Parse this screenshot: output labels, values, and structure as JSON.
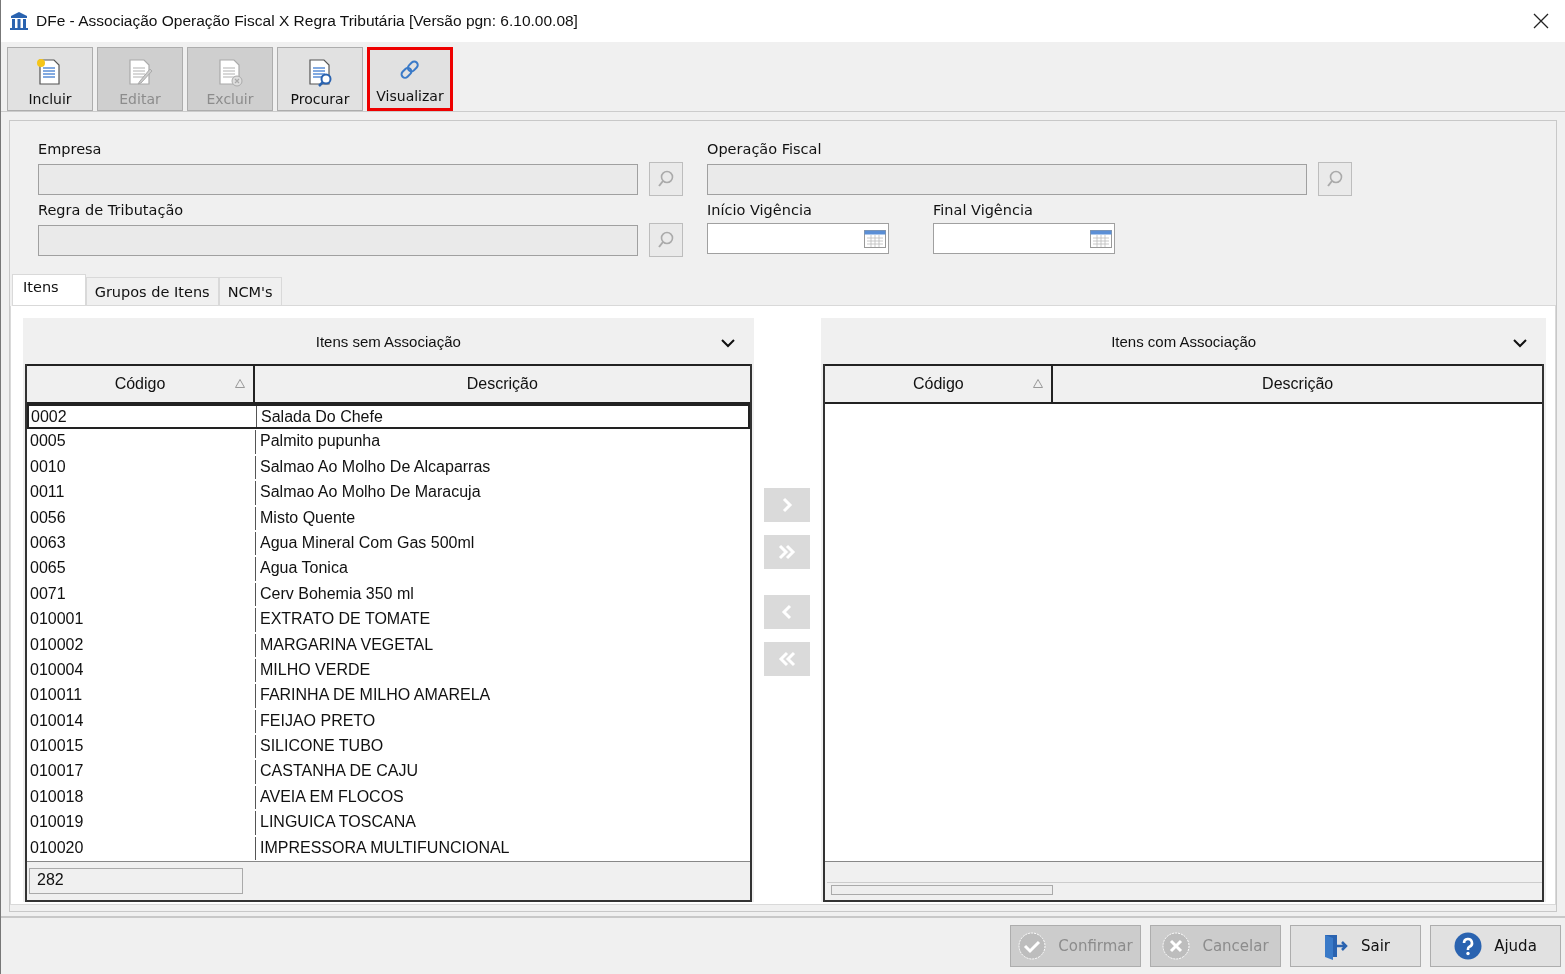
{
  "window": {
    "title": "DFe - Associação Operação Fiscal X Regra Tributária [Versão pgn: 6.10.00.08]"
  },
  "toolbar": [
    {
      "kind": "new",
      "label": "Incluir",
      "disabled": false,
      "highlighted": false
    },
    {
      "kind": "edit",
      "label": "Editar",
      "disabled": true,
      "highlighted": false
    },
    {
      "kind": "delete",
      "label": "Excluir",
      "disabled": true,
      "highlighted": false
    },
    {
      "kind": "search",
      "label": "Procurar",
      "disabled": false,
      "highlighted": false
    },
    {
      "kind": "link",
      "label": "Visualizar",
      "disabled": false,
      "highlighted": true
    }
  ],
  "form": {
    "fields": [
      {
        "kind": "lookup",
        "label": "Empresa"
      },
      {
        "kind": "lookup",
        "label": "Operação Fiscal"
      },
      {
        "kind": "lookup",
        "label": "Regra de Tributação"
      },
      {
        "kind": "date",
        "label": "Início Vigência"
      },
      {
        "kind": "date",
        "label": "Final Vigência"
      }
    ]
  },
  "tabs": [
    {
      "label": "Itens",
      "selected": true
    },
    {
      "label": "Grupos de Itens",
      "selected": false
    },
    {
      "label": "NCM's",
      "selected": false
    }
  ],
  "left_list": {
    "title": "Itens sem Associação",
    "columns": [
      "Código",
      "Descrição"
    ],
    "count": "282",
    "rows": [
      {
        "code": "0002",
        "description": "Salada Do Chefe",
        "selected": true
      },
      {
        "code": "0005",
        "description": "Palmito pupunha",
        "selected": false
      },
      {
        "code": "0010",
        "description": "Salmao Ao Molho De Alcaparras",
        "selected": false
      },
      {
        "code": "0011",
        "description": "Salmao Ao Molho De Maracuja",
        "selected": false
      },
      {
        "code": "0056",
        "description": "Misto Quente",
        "selected": false
      },
      {
        "code": "0063",
        "description": "Agua Mineral Com Gas 500ml",
        "selected": false
      },
      {
        "code": "0065",
        "description": "Agua Tonica",
        "selected": false
      },
      {
        "code": "0071",
        "description": "Cerv Bohemia 350 ml",
        "selected": false
      },
      {
        "code": "010001",
        "description": "EXTRATO DE TOMATE",
        "selected": false
      },
      {
        "code": "010002",
        "description": "MARGARINA VEGETAL",
        "selected": false
      },
      {
        "code": "010004",
        "description": "MILHO VERDE",
        "selected": false
      },
      {
        "code": "010011",
        "description": "FARINHA DE MILHO AMARELA",
        "selected": false
      },
      {
        "code": "010014",
        "description": "FEIJAO PRETO",
        "selected": false
      },
      {
        "code": "010015",
        "description": "SILICONE TUBO",
        "selected": false
      },
      {
        "code": "010017",
        "description": "CASTANHA DE CAJU",
        "selected": false
      },
      {
        "code": "010018",
        "description": "AVEIA EM FLOCOS",
        "selected": false
      },
      {
        "code": "010019",
        "description": "LINGUICA TOSCANA",
        "selected": false
      },
      {
        "code": "010020",
        "description": "IMPRESSORA MULTIFUNCIONAL",
        "selected": false
      }
    ]
  },
  "transfer_buttons": [
    {
      "kind": "right",
      "disabled": true
    },
    {
      "kind": "all-right",
      "disabled": true
    },
    {
      "kind": "left",
      "disabled": true
    },
    {
      "kind": "all-left",
      "disabled": true
    }
  ],
  "right_list": {
    "title": "Itens com Associação",
    "columns": [
      "Código",
      "Descrição"
    ]
  },
  "footer_buttons": [
    {
      "kind": "confirm",
      "label": "Confirmar",
      "disabled": true
    },
    {
      "kind": "cancel",
      "label": "Cancelar",
      "disabled": true
    },
    {
      "kind": "exit",
      "label": "Sair",
      "disabled": false
    },
    {
      "kind": "help",
      "label": "Ajuda",
      "disabled": false
    }
  ]
}
